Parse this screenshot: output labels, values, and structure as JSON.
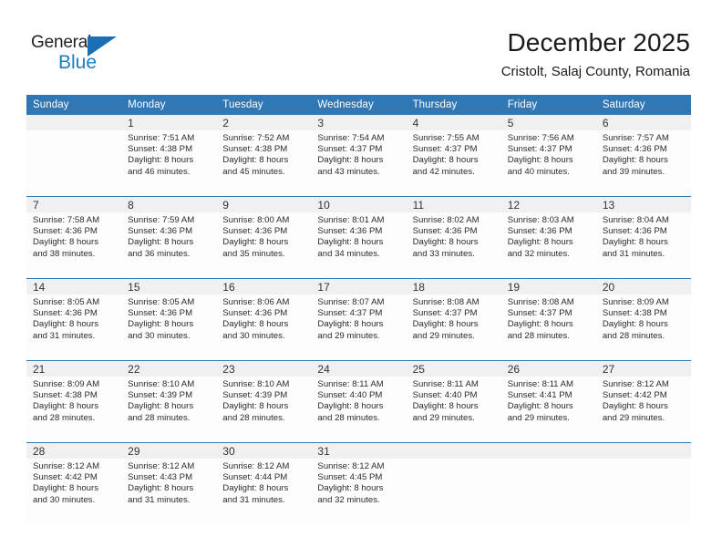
{
  "brand": {
    "name_part1": "General",
    "name_part2": "Blue",
    "triangle_color": "#1a6fb5",
    "blue_text_color": "#1a7ec2"
  },
  "header": {
    "title": "December 2025",
    "subtitle": "Cristolt, Salaj County, Romania",
    "accent_color": "#3077b6"
  },
  "weekdays": [
    "Sunday",
    "Monday",
    "Tuesday",
    "Wednesday",
    "Thursday",
    "Friday",
    "Saturday"
  ],
  "labels": {
    "sunrise_prefix": "Sunrise:",
    "sunset_prefix": "Sunset:",
    "daylight_prefix": "Daylight:"
  },
  "weeks": [
    [
      {
        "day": "",
        "sunrise": "",
        "sunset": "",
        "daylight1": "",
        "daylight2": ""
      },
      {
        "day": "1",
        "sunrise": "Sunrise: 7:51 AM",
        "sunset": "Sunset: 4:38 PM",
        "daylight1": "Daylight: 8 hours",
        "daylight2": "and 46 minutes."
      },
      {
        "day": "2",
        "sunrise": "Sunrise: 7:52 AM",
        "sunset": "Sunset: 4:38 PM",
        "daylight1": "Daylight: 8 hours",
        "daylight2": "and 45 minutes."
      },
      {
        "day": "3",
        "sunrise": "Sunrise: 7:54 AM",
        "sunset": "Sunset: 4:37 PM",
        "daylight1": "Daylight: 8 hours",
        "daylight2": "and 43 minutes."
      },
      {
        "day": "4",
        "sunrise": "Sunrise: 7:55 AM",
        "sunset": "Sunset: 4:37 PM",
        "daylight1": "Daylight: 8 hours",
        "daylight2": "and 42 minutes."
      },
      {
        "day": "5",
        "sunrise": "Sunrise: 7:56 AM",
        "sunset": "Sunset: 4:37 PM",
        "daylight1": "Daylight: 8 hours",
        "daylight2": "and 40 minutes."
      },
      {
        "day": "6",
        "sunrise": "Sunrise: 7:57 AM",
        "sunset": "Sunset: 4:36 PM",
        "daylight1": "Daylight: 8 hours",
        "daylight2": "and 39 minutes."
      }
    ],
    [
      {
        "day": "7",
        "sunrise": "Sunrise: 7:58 AM",
        "sunset": "Sunset: 4:36 PM",
        "daylight1": "Daylight: 8 hours",
        "daylight2": "and 38 minutes."
      },
      {
        "day": "8",
        "sunrise": "Sunrise: 7:59 AM",
        "sunset": "Sunset: 4:36 PM",
        "daylight1": "Daylight: 8 hours",
        "daylight2": "and 36 minutes."
      },
      {
        "day": "9",
        "sunrise": "Sunrise: 8:00 AM",
        "sunset": "Sunset: 4:36 PM",
        "daylight1": "Daylight: 8 hours",
        "daylight2": "and 35 minutes."
      },
      {
        "day": "10",
        "sunrise": "Sunrise: 8:01 AM",
        "sunset": "Sunset: 4:36 PM",
        "daylight1": "Daylight: 8 hours",
        "daylight2": "and 34 minutes."
      },
      {
        "day": "11",
        "sunrise": "Sunrise: 8:02 AM",
        "sunset": "Sunset: 4:36 PM",
        "daylight1": "Daylight: 8 hours",
        "daylight2": "and 33 minutes."
      },
      {
        "day": "12",
        "sunrise": "Sunrise: 8:03 AM",
        "sunset": "Sunset: 4:36 PM",
        "daylight1": "Daylight: 8 hours",
        "daylight2": "and 32 minutes."
      },
      {
        "day": "13",
        "sunrise": "Sunrise: 8:04 AM",
        "sunset": "Sunset: 4:36 PM",
        "daylight1": "Daylight: 8 hours",
        "daylight2": "and 31 minutes."
      }
    ],
    [
      {
        "day": "14",
        "sunrise": "Sunrise: 8:05 AM",
        "sunset": "Sunset: 4:36 PM",
        "daylight1": "Daylight: 8 hours",
        "daylight2": "and 31 minutes."
      },
      {
        "day": "15",
        "sunrise": "Sunrise: 8:05 AM",
        "sunset": "Sunset: 4:36 PM",
        "daylight1": "Daylight: 8 hours",
        "daylight2": "and 30 minutes."
      },
      {
        "day": "16",
        "sunrise": "Sunrise: 8:06 AM",
        "sunset": "Sunset: 4:36 PM",
        "daylight1": "Daylight: 8 hours",
        "daylight2": "and 30 minutes."
      },
      {
        "day": "17",
        "sunrise": "Sunrise: 8:07 AM",
        "sunset": "Sunset: 4:37 PM",
        "daylight1": "Daylight: 8 hours",
        "daylight2": "and 29 minutes."
      },
      {
        "day": "18",
        "sunrise": "Sunrise: 8:08 AM",
        "sunset": "Sunset: 4:37 PM",
        "daylight1": "Daylight: 8 hours",
        "daylight2": "and 29 minutes."
      },
      {
        "day": "19",
        "sunrise": "Sunrise: 8:08 AM",
        "sunset": "Sunset: 4:37 PM",
        "daylight1": "Daylight: 8 hours",
        "daylight2": "and 28 minutes."
      },
      {
        "day": "20",
        "sunrise": "Sunrise: 8:09 AM",
        "sunset": "Sunset: 4:38 PM",
        "daylight1": "Daylight: 8 hours",
        "daylight2": "and 28 minutes."
      }
    ],
    [
      {
        "day": "21",
        "sunrise": "Sunrise: 8:09 AM",
        "sunset": "Sunset: 4:38 PM",
        "daylight1": "Daylight: 8 hours",
        "daylight2": "and 28 minutes."
      },
      {
        "day": "22",
        "sunrise": "Sunrise: 8:10 AM",
        "sunset": "Sunset: 4:39 PM",
        "daylight1": "Daylight: 8 hours",
        "daylight2": "and 28 minutes."
      },
      {
        "day": "23",
        "sunrise": "Sunrise: 8:10 AM",
        "sunset": "Sunset: 4:39 PM",
        "daylight1": "Daylight: 8 hours",
        "daylight2": "and 28 minutes."
      },
      {
        "day": "24",
        "sunrise": "Sunrise: 8:11 AM",
        "sunset": "Sunset: 4:40 PM",
        "daylight1": "Daylight: 8 hours",
        "daylight2": "and 28 minutes."
      },
      {
        "day": "25",
        "sunrise": "Sunrise: 8:11 AM",
        "sunset": "Sunset: 4:40 PM",
        "daylight1": "Daylight: 8 hours",
        "daylight2": "and 29 minutes."
      },
      {
        "day": "26",
        "sunrise": "Sunrise: 8:11 AM",
        "sunset": "Sunset: 4:41 PM",
        "daylight1": "Daylight: 8 hours",
        "daylight2": "and 29 minutes."
      },
      {
        "day": "27",
        "sunrise": "Sunrise: 8:12 AM",
        "sunset": "Sunset: 4:42 PM",
        "daylight1": "Daylight: 8 hours",
        "daylight2": "and 29 minutes."
      }
    ],
    [
      {
        "day": "28",
        "sunrise": "Sunrise: 8:12 AM",
        "sunset": "Sunset: 4:42 PM",
        "daylight1": "Daylight: 8 hours",
        "daylight2": "and 30 minutes."
      },
      {
        "day": "29",
        "sunrise": "Sunrise: 8:12 AM",
        "sunset": "Sunset: 4:43 PM",
        "daylight1": "Daylight: 8 hours",
        "daylight2": "and 31 minutes."
      },
      {
        "day": "30",
        "sunrise": "Sunrise: 8:12 AM",
        "sunset": "Sunset: 4:44 PM",
        "daylight1": "Daylight: 8 hours",
        "daylight2": "and 31 minutes."
      },
      {
        "day": "31",
        "sunrise": "Sunrise: 8:12 AM",
        "sunset": "Sunset: 4:45 PM",
        "daylight1": "Daylight: 8 hours",
        "daylight2": "and 32 minutes."
      },
      {
        "day": "",
        "sunrise": "",
        "sunset": "",
        "daylight1": "",
        "daylight2": ""
      },
      {
        "day": "",
        "sunrise": "",
        "sunset": "",
        "daylight1": "",
        "daylight2": ""
      },
      {
        "day": "",
        "sunrise": "",
        "sunset": "",
        "daylight1": "",
        "daylight2": ""
      }
    ]
  ]
}
